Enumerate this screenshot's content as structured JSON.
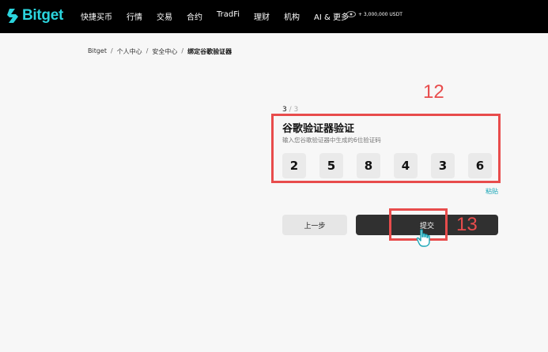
{
  "header": {
    "logo_text": "Bitget",
    "nav": [
      "快捷买币",
      "行情",
      "交易",
      "合约",
      "TradFi",
      "理财",
      "机构",
      "AI & 更多"
    ],
    "promo_text": "+ 3,000,000 USDT",
    "accent_color": "#2bd4dd"
  },
  "breadcrumb": [
    "Bitget",
    "个人中心",
    "安全中心",
    "绑定谷歌验证器"
  ],
  "step": {
    "current": "3",
    "total": "/ 3"
  },
  "form": {
    "title": "谷歌验证器验证",
    "subtitle": "输入您谷歌验证器中生成的6位验证码",
    "digits": [
      "2",
      "5",
      "8",
      "4",
      "3",
      "6"
    ],
    "paste_label": "粘贴"
  },
  "buttons": {
    "prev": "上一步",
    "submit": "提交"
  },
  "annotations": {
    "box1": "12",
    "box2": "13",
    "color": "#e84c4c"
  }
}
